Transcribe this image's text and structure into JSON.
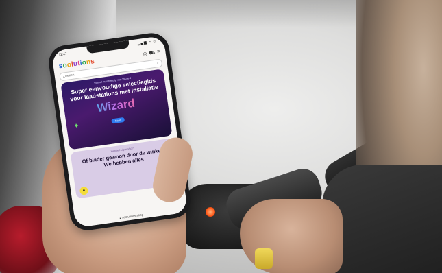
{
  "status": {
    "time": "11:47",
    "icons": "▂▄▆ ◔ ▭"
  },
  "app": {
    "logo_letters": [
      "s",
      "o",
      "o",
      "l",
      "u",
      "t",
      "i",
      "o",
      "n",
      "s"
    ],
    "search_placeholder": "Zoeken..."
  },
  "wizard_card": {
    "eyebrow": "Winkel met behulp van Wizard",
    "title": "Super eenvoudige selectiegids voor laadstations met installatie",
    "wizard_word": "Wizard",
    "button": "Start"
  },
  "browse_card": {
    "eyebrow": "Heb je hulp nodig?",
    "title_line1": "Of blader gewoon door de winkel!",
    "title_line2": "We hebben alles"
  },
  "browser": {
    "url": "soolutions.shop"
  },
  "colors": {
    "wizard_bg": "#2b1a66",
    "browse_bg": "#d9cce6",
    "accent_blue": "#2f7cf0"
  }
}
